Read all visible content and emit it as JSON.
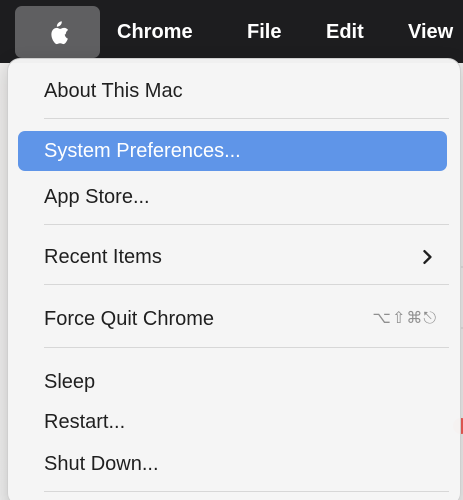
{
  "menu_bar": {
    "apple_icon": "apple-logo-icon",
    "items": [
      "Chrome",
      "File",
      "Edit",
      "View"
    ]
  },
  "apple_menu": {
    "items": [
      {
        "label": "About This Mac"
      },
      {
        "label": "System Preferences..."
      },
      {
        "label": "App Store..."
      },
      {
        "label": "Recent Items",
        "submenu_icon": "chevron-right-icon"
      },
      {
        "label": "Force Quit Chrome",
        "shortcut": "⌥⇧⌘⎋"
      },
      {
        "label": "Sleep"
      },
      {
        "label": "Restart..."
      },
      {
        "label": "Shut Down..."
      }
    ],
    "highlighted_item": "System Preferences..."
  },
  "colors": {
    "menu_bar_bg": "#1d1d1f",
    "apple_tile_bg": "#5f5f61",
    "menu_bg": "#f5f5f5",
    "highlight_bg": "#5f95e8",
    "separator": "#d7d7d7",
    "text": "#1f1f1f",
    "shortcut_text": "#8f8f8f"
  }
}
